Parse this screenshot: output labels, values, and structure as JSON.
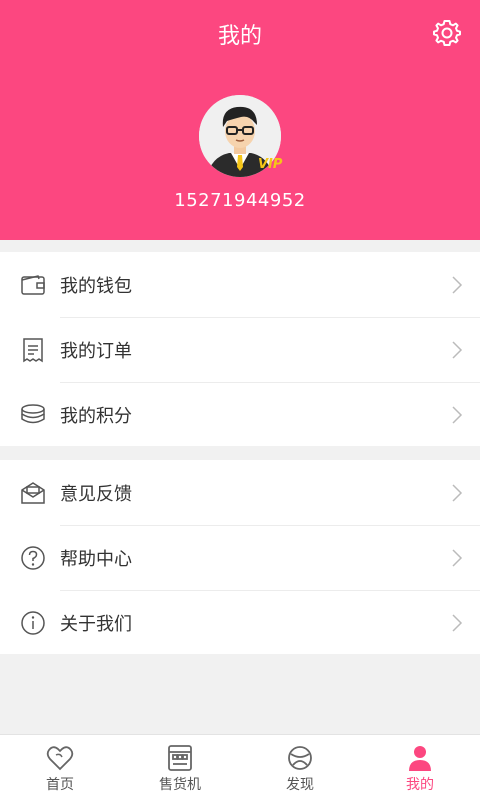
{
  "header": {
    "title": "我的",
    "phone": "15271944952",
    "vip_badge": "VIP",
    "bg_color": "#fc4780"
  },
  "menu_group_1": [
    {
      "label": "我的钱包",
      "icon": "wallet-icon"
    },
    {
      "label": "我的订单",
      "icon": "receipt-icon"
    },
    {
      "label": "我的积分",
      "icon": "coins-icon"
    }
  ],
  "menu_group_2": [
    {
      "label": "意见反馈",
      "icon": "mail-icon"
    },
    {
      "label": "帮助中心",
      "icon": "help-icon"
    },
    {
      "label": "关于我们",
      "icon": "info-icon"
    }
  ],
  "tabbar": {
    "items": [
      {
        "label": "首页",
        "icon": "heart-icon"
      },
      {
        "label": "售货机",
        "icon": "vending-machine-icon"
      },
      {
        "label": "发现",
        "icon": "discover-icon"
      },
      {
        "label": "我的",
        "icon": "person-icon",
        "active": true
      }
    ],
    "active_color": "#fc4780"
  }
}
